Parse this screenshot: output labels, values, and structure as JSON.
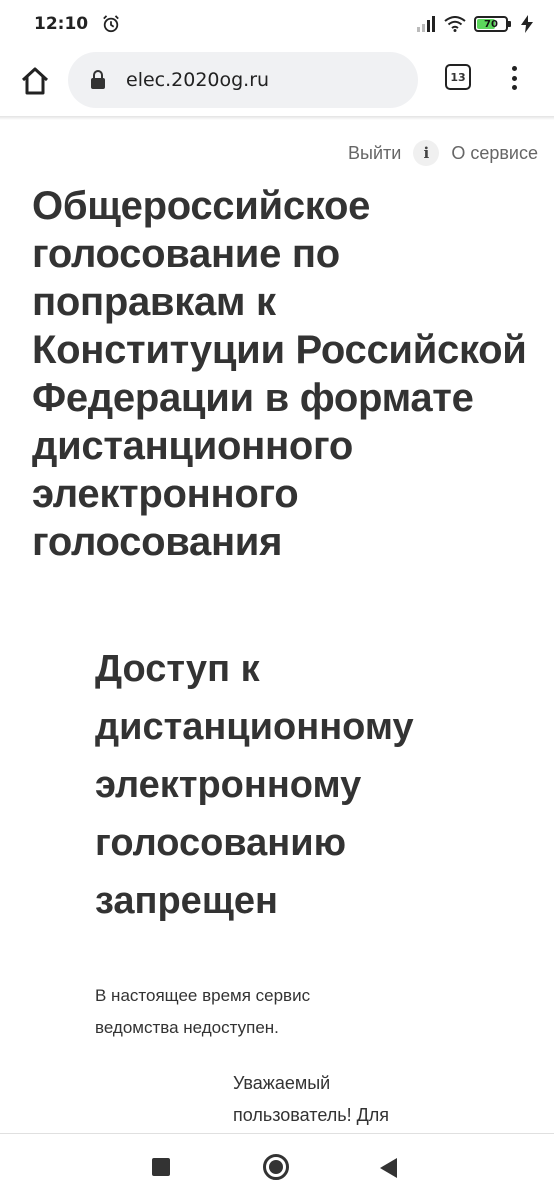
{
  "status_bar": {
    "time": "12:10",
    "battery_level": "70",
    "battery_fraction": 0.7,
    "icons": [
      "alarm-icon",
      "signal-icon",
      "wifi-icon",
      "battery-icon",
      "charging-icon"
    ]
  },
  "browser": {
    "url": "elec.2020og.ru",
    "tab_count": "13",
    "icons": [
      "home-icon",
      "lock-icon",
      "tabs-icon",
      "menu-icon"
    ]
  },
  "header_links": {
    "logout": "Выйти",
    "info_glyph": "i",
    "about": "О сервисе"
  },
  "main": {
    "title": "Общероссийское голосование по поправкам к Конституции Российской Федерации в формате дистанционного электронного голосования",
    "access_title": "Доступ к дистанционному электронному голосованию запрещен",
    "access_message": "В настоящее время сервис ведомства недоступен.",
    "greeting": "Уважаемый пользователь! Для"
  },
  "colors": {
    "text": "#333333",
    "muted": "#666666",
    "url_pill": "#f0f1f3",
    "battery": "#5cd65c"
  }
}
